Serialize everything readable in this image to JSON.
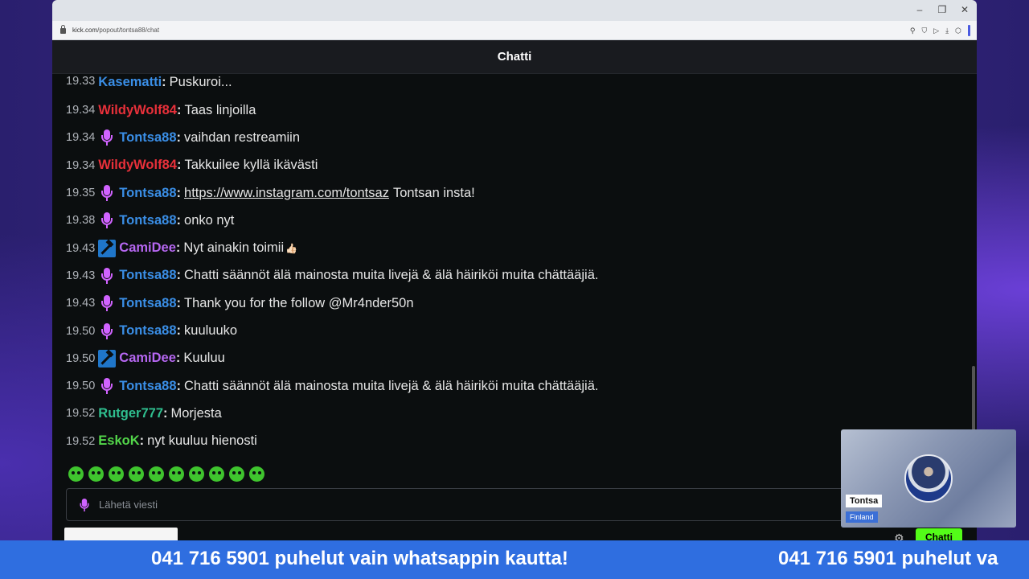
{
  "browser": {
    "url_domain": "kick.com",
    "url_path": "/popout/tontsa88/chat"
  },
  "chat": {
    "title": "Chatti",
    "input_placeholder": "Lähetä viesti",
    "send_label": "Chatti",
    "messages": [
      {
        "time": "19.33",
        "badge": "",
        "user": "Kasematti",
        "color": "#3a8ee6",
        "text": "Puskuroi..."
      },
      {
        "time": "19.34",
        "badge": "",
        "user": "WildyWolf84",
        "color": "#e8303a",
        "text": "Taas linjoilla"
      },
      {
        "time": "19.34",
        "badge": "mic",
        "user": "Tontsa88",
        "color": "#3a8ee6",
        "text": "vaihdan restreamiin"
      },
      {
        "time": "19.34",
        "badge": "",
        "user": "WildyWolf84",
        "color": "#e8303a",
        "text": "Takkuilee kyllä ikävästi"
      },
      {
        "time": "19.35",
        "badge": "mic",
        "user": "Tontsa88",
        "color": "#3a8ee6",
        "link": "https://www.instagram.com/tontsaz",
        "text": "Tontsan insta!"
      },
      {
        "time": "19.38",
        "badge": "mic",
        "user": "Tontsa88",
        "color": "#3a8ee6",
        "text": "onko nyt"
      },
      {
        "time": "19.43",
        "badge": "hammer",
        "user": "CamiDee",
        "color": "#b667f1",
        "text": "Nyt ainakin toimii",
        "emoji": "👍🏻"
      },
      {
        "time": "19.43",
        "badge": "mic",
        "user": "Tontsa88",
        "color": "#3a8ee6",
        "text": "Chatti säännöt älä mainosta muita livejä & älä häiriköi muita chättääjiä."
      },
      {
        "time": "19.43",
        "badge": "mic",
        "user": "Tontsa88",
        "color": "#3a8ee6",
        "text": "Thank you for the follow @Mr4nder50n"
      },
      {
        "time": "19.50",
        "badge": "mic",
        "user": "Tontsa88",
        "color": "#3a8ee6",
        "text": "kuuluuko"
      },
      {
        "time": "19.50",
        "badge": "hammer",
        "user": "CamiDee",
        "color": "#b667f1",
        "text": "Kuuluu"
      },
      {
        "time": "19.50",
        "badge": "mic",
        "user": "Tontsa88",
        "color": "#3a8ee6",
        "text": "Chatti säännöt älä mainosta muita livejä & älä häiriköi muita chättääjiä."
      },
      {
        "time": "19.52",
        "badge": "",
        "user": "Rutger777",
        "color": "#2fbf8f",
        "text": "Morjesta"
      },
      {
        "time": "19.52",
        "badge": "",
        "user": "EskoK",
        "color": "#53d64a",
        "text": "nyt kuuluu hienosti"
      }
    ],
    "emote_count": 10
  },
  "webcam": {
    "name": "Tontsa",
    "country": "Finland"
  },
  "ticker": {
    "text": "041 716 5901 puhelut vain whatsappin kautta!",
    "text_repeat": "041 716 5901 puhelut va"
  }
}
